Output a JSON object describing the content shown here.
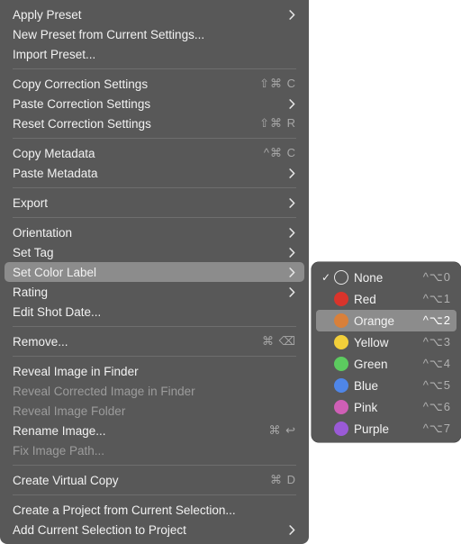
{
  "main_menu": {
    "groups": [
      [
        {
          "label": "Apply Preset",
          "submenu": true
        },
        {
          "label": "New Preset from Current Settings..."
        },
        {
          "label": "Import Preset..."
        }
      ],
      [
        {
          "label": "Copy Correction Settings",
          "shortcut": "⇧⌘ C"
        },
        {
          "label": "Paste Correction Settings",
          "submenu": true
        },
        {
          "label": "Reset Correction Settings",
          "shortcut": "⇧⌘ R"
        }
      ],
      [
        {
          "label": "Copy Metadata",
          "shortcut": "^⌘ C"
        },
        {
          "label": "Paste Metadata",
          "submenu": true
        }
      ],
      [
        {
          "label": "Export",
          "submenu": true
        }
      ],
      [
        {
          "label": "Orientation",
          "submenu": true
        },
        {
          "label": "Set Tag",
          "submenu": true
        },
        {
          "label": "Set Color Label",
          "submenu": true,
          "selected": true
        },
        {
          "label": "Rating",
          "submenu": true
        },
        {
          "label": "Edit Shot Date..."
        }
      ],
      [
        {
          "label": "Remove...",
          "shortcut": "⌘ ⌫"
        }
      ],
      [
        {
          "label": "Reveal Image in Finder"
        },
        {
          "label": "Reveal Corrected Image in Finder",
          "disabled": true
        },
        {
          "label": "Reveal Image Folder",
          "disabled": true
        },
        {
          "label": "Rename Image...",
          "shortcut": "⌘ ↩"
        },
        {
          "label": "Fix Image Path...",
          "disabled": true
        }
      ],
      [
        {
          "label": "Create Virtual Copy",
          "shortcut": "⌘ D"
        }
      ],
      [
        {
          "label": "Create a Project from Current Selection..."
        },
        {
          "label": "Add Current Selection to Project",
          "submenu": true
        }
      ]
    ]
  },
  "color_submenu": {
    "items": [
      {
        "label": "None",
        "color": "none",
        "shortcut": "^⌥0",
        "checked": true
      },
      {
        "label": "Red",
        "color": "#d9342b",
        "shortcut": "^⌥1"
      },
      {
        "label": "Orange",
        "color": "#d9803a",
        "shortcut": "^⌥2",
        "selected": true
      },
      {
        "label": "Yellow",
        "color": "#f2cf3a",
        "shortcut": "^⌥3"
      },
      {
        "label": "Green",
        "color": "#5ccb5f",
        "shortcut": "^⌥4"
      },
      {
        "label": "Blue",
        "color": "#4f86e8",
        "shortcut": "^⌥5"
      },
      {
        "label": "Pink",
        "color": "#cf5fb6",
        "shortcut": "^⌥6"
      },
      {
        "label": "Purple",
        "color": "#9a5ad6",
        "shortcut": "^⌥7"
      }
    ]
  },
  "icons": {
    "submenu_arrow": "chevron-right-icon",
    "checkmark": "checkmark-icon"
  }
}
